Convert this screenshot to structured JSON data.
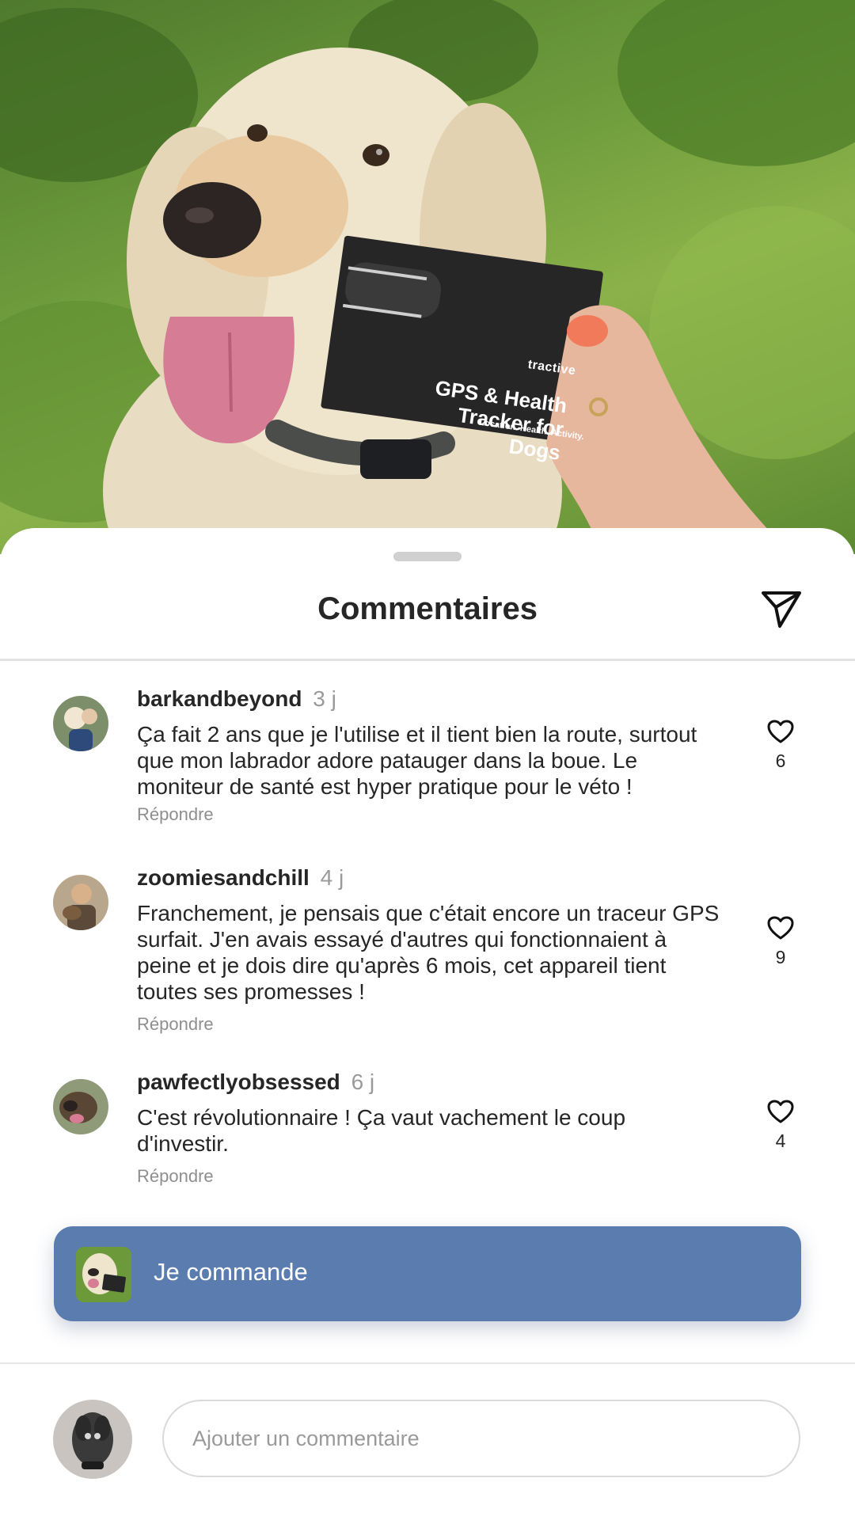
{
  "photo": {
    "product": {
      "brand": "tractive",
      "title_line1": "GPS & Health",
      "title_line2": "Tracker for Dogs",
      "tagline": "Location. Health. Activity."
    }
  },
  "sheet": {
    "title": "Commentaires",
    "share_icon": "send-icon"
  },
  "comments": [
    {
      "username": "barkandbeyond",
      "time": "3 j",
      "text": "Ça fait 2 ans que je l'utilise et il tient bien la route, surtout que mon labrador adore patauger dans la boue. Le moniteur de santé est hyper pratique pour le véto !",
      "reply_label": "Répondre",
      "likes": "6"
    },
    {
      "username": "zoomiesandchill",
      "time": "4 j",
      "text": "Franchement, je pensais que c'était encore un traceur GPS surfait. J'en avais essayé d'autres qui fonctionnaient à peine et je dois dire qu'après 6 mois, cet appareil tient toutes ses promesses !",
      "reply_label": "Répondre",
      "likes": "9"
    },
    {
      "username": "pawfectlyobsessed",
      "time": "6 j",
      "text": "C'est révolutionnaire ! Ça vaut vachement le coup d'investir.",
      "reply_label": "Répondre",
      "likes": "4"
    }
  ],
  "cta": {
    "label": "Je commande",
    "color": "#5a7caf"
  },
  "composer": {
    "placeholder": "Ajouter un commentaire"
  }
}
